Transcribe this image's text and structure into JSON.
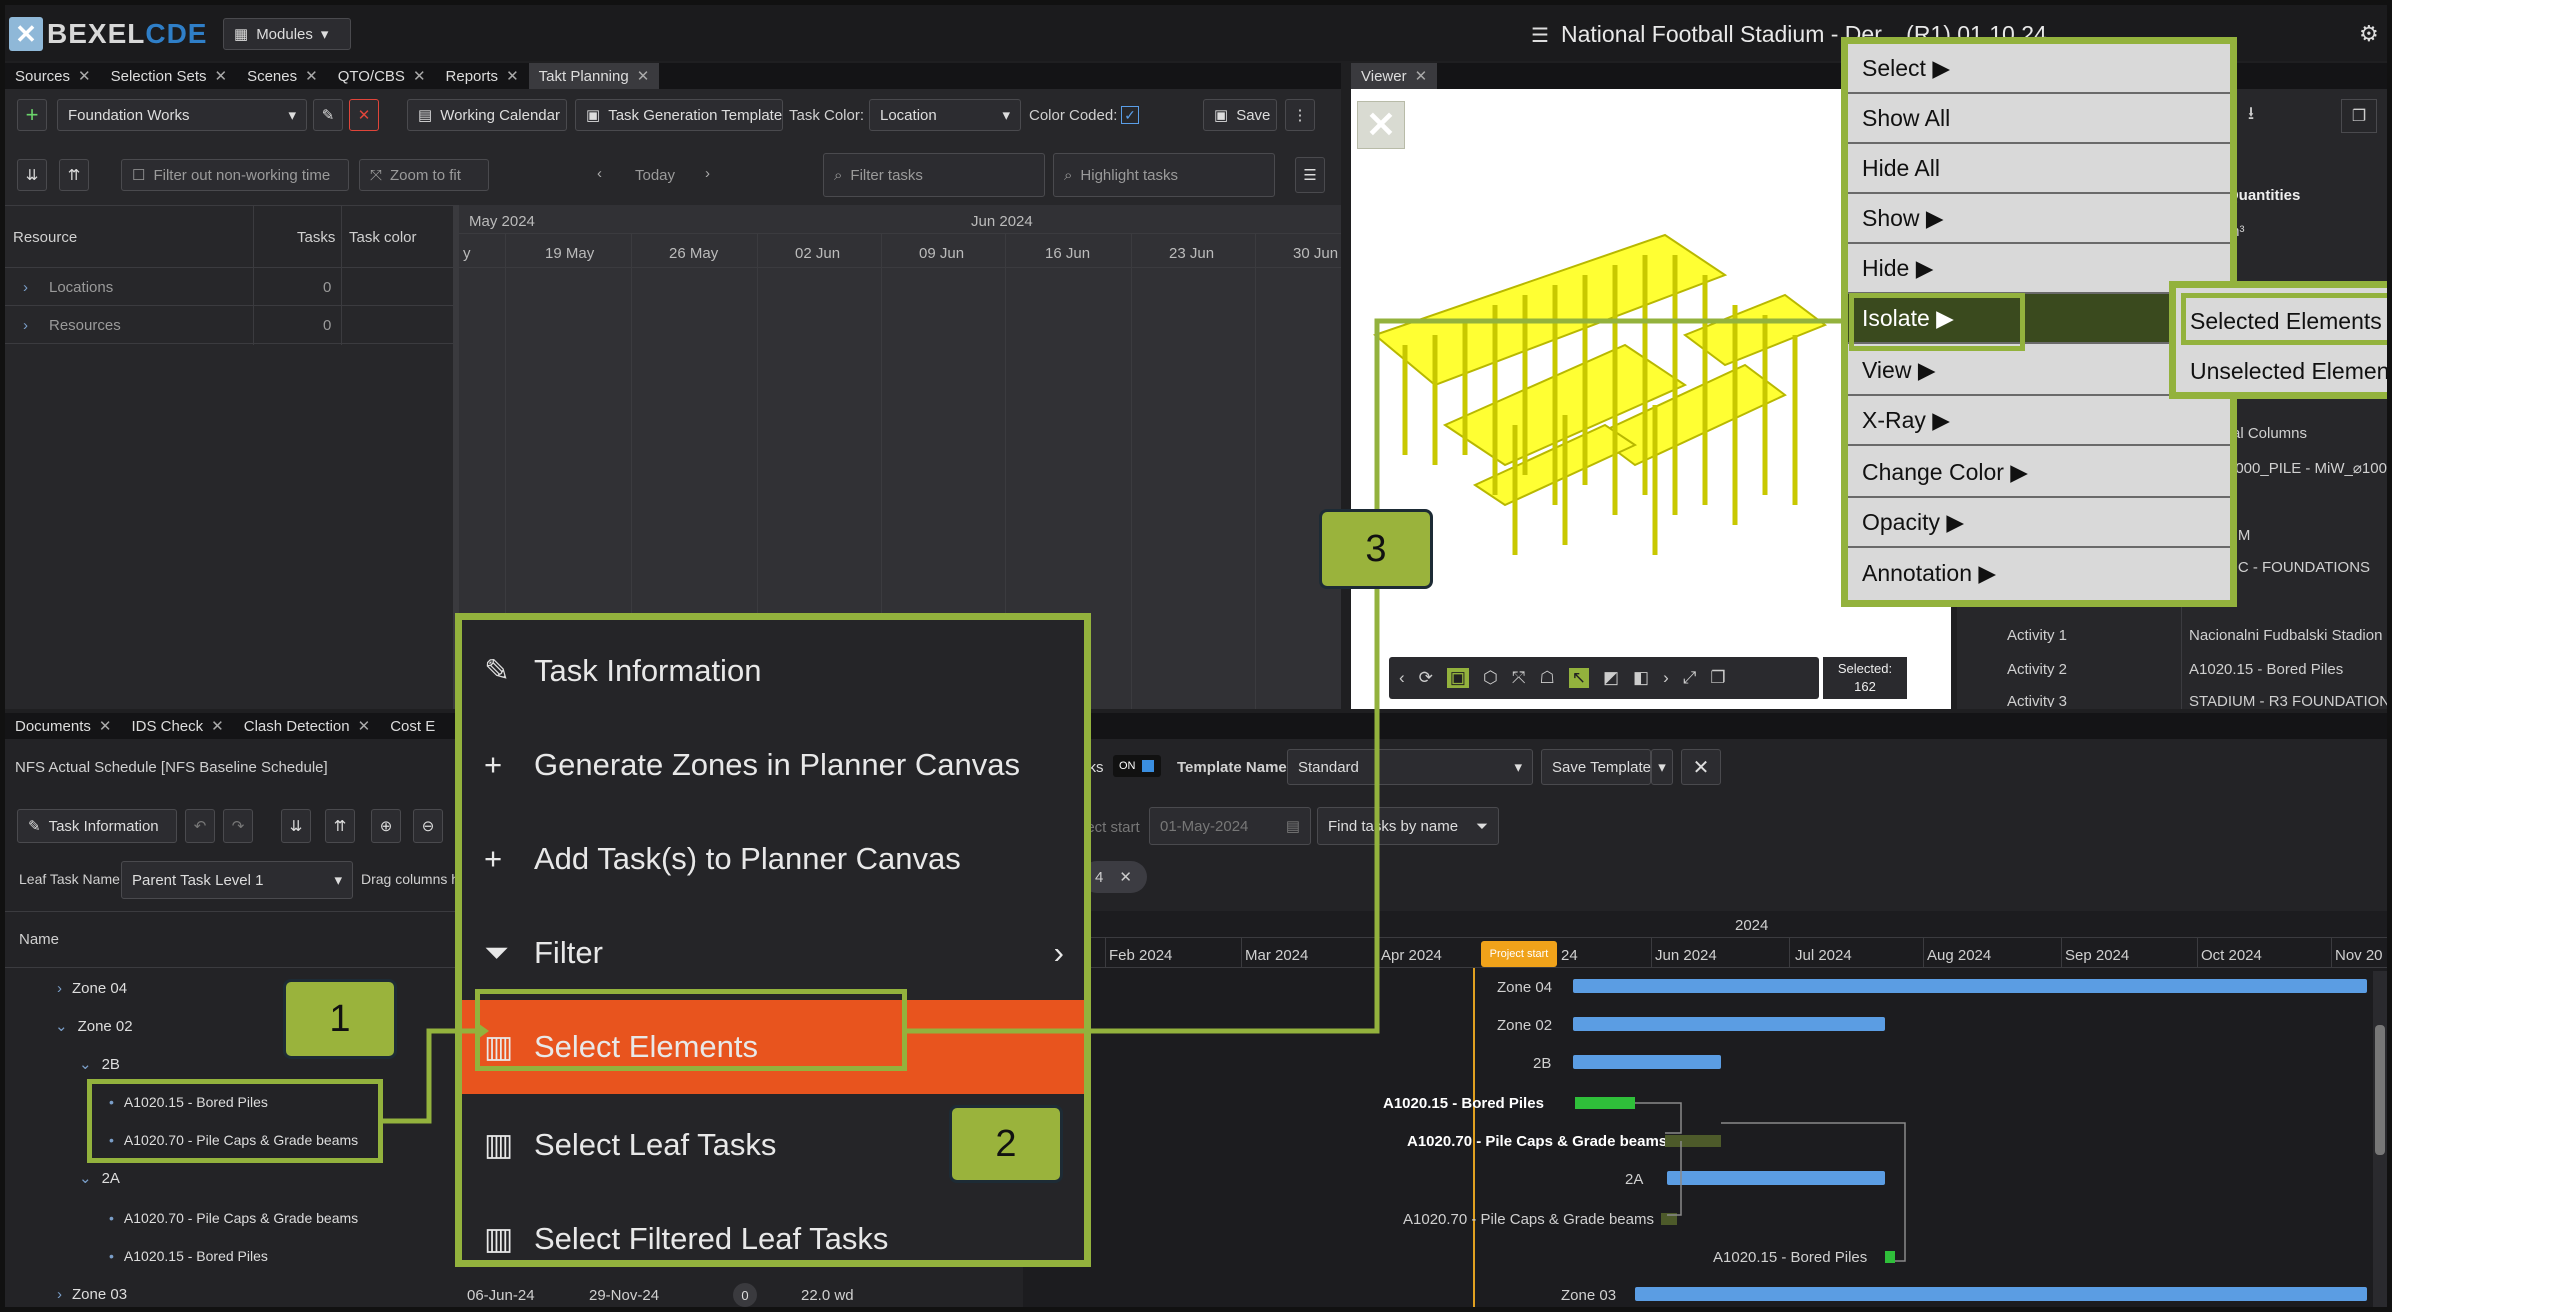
{
  "app": {
    "brand_a": "BEXEL",
    "brand_b": "CDE",
    "modules": "Modules",
    "title": "National Football Stadium - Der... (R1) 01.10.24"
  },
  "colors": {
    "accent": "#93b23d",
    "badge": "#9ab33c",
    "highlight": "#e8541e",
    "bar_blue": "#5b9de3",
    "bar_green": "#2fbf3a",
    "model_yellow": "#ffff33"
  },
  "top_tabs": [
    "Sources",
    "Selection Sets",
    "Scenes",
    "QTO/CBS",
    "Reports",
    "Takt Planning"
  ],
  "takt": {
    "project": "Foundation Works",
    "working_calendar": "Working Calendar",
    "task_gen_template": "Task Generation Template",
    "task_color_label": "Task Color:",
    "task_color_value": "Location",
    "color_coded_label": "Color Coded:",
    "save": "Save",
    "filter_nonworking": "Filter out non-working time",
    "zoom_fit": "Zoom to fit",
    "today": "Today",
    "filter_tasks": "Filter tasks",
    "highlight_tasks": "Highlight tasks",
    "columns": {
      "resource": "Resource",
      "tasks": "Tasks",
      "task_color": "Task color"
    },
    "rows": [
      {
        "name": "Locations",
        "tasks": "0"
      },
      {
        "name": "Resources",
        "tasks": "0"
      }
    ],
    "months": [
      "May 2024",
      "Jun 2024"
    ],
    "weeks": [
      "y",
      "19 May",
      "26 May",
      "02 Jun",
      "09 Jun",
      "16 Jun",
      "23 Jun",
      "30 Jun"
    ]
  },
  "viewer": {
    "tab": "Viewer",
    "selected_label": "Selected:",
    "selected_count": "162"
  },
  "props": {
    "header": "Quantities",
    "unit": "m³",
    "rows": [
      {
        "k": "",
        "v": "ral Columns"
      },
      {
        "k": "",
        "v": "1000_PILE - MiW_⌀100"
      },
      {
        "k": "",
        "v": "UM"
      },
      {
        "k": "",
        "v": "RC - FOUNDATIONS"
      },
      {
        "k": "Activity 1",
        "v": "Nacionalni Fudbalski Stadion"
      },
      {
        "k": "Activity 2",
        "v": "A1020.15 - Bored Piles"
      },
      {
        "k": "Activity 3",
        "v": "STADIUM - R3 FOUNDATION"
      }
    ]
  },
  "bottom_tabs": [
    "Documents",
    "IDS Check",
    "Clash Detection",
    "Cost E"
  ],
  "schedule": {
    "title": "NFS Actual Schedule [NFS Baseline Schedule]",
    "task_info": "Task Information",
    "leaf_label": "Leaf Task Name:",
    "leaf_value": "Parent Task Level 1",
    "drag_hint": "Drag columns h",
    "name_col": "Name",
    "toggle_label": "sks",
    "toggle_state": "ON",
    "template_label": "Template Name:",
    "template_value": "Standard",
    "save_template": "Save Template",
    "project_start_label": "ject start",
    "project_start_date": "01-May-2024",
    "find_tasks": "Find tasks by name",
    "chip": "4",
    "tree": [
      "Zone 04",
      "Zone 02",
      "2B",
      "A1020.15 - Bored Piles",
      "A1020.70 - Pile Caps & Grade beams",
      "2A",
      "A1020.70 - Pile Caps & Grade beams",
      "A1020.15 - Bored Piles",
      "Zone 03"
    ],
    "zone03_start": "06-Jun-24",
    "zone03_end": "29-Nov-24",
    "zone03_count": "0",
    "zone03_dur": "22.0 wd",
    "year": "2024",
    "months": [
      "Feb 2024",
      "Mar 2024",
      "Apr 2024",
      "Jun 2024",
      "Jul 2024",
      "Aug 2024",
      "Sep 2024",
      "Oct 2024",
      "Nov 20"
    ],
    "apr_tail": "24",
    "project_start": "Project start",
    "bar_labels": [
      "Zone 04",
      "Zone 02",
      "2B",
      "A1020.15 - Bored Piles",
      "A1020.70 - Pile Caps & Grade beams",
      "2A",
      "A1020.70 - Pile Caps & Grade beams",
      "A1020.15 - Bored Piles",
      "Zone 03"
    ]
  },
  "context_menu": [
    "Task Information",
    "Generate Zones in Planner Canvas",
    "Add Task(s) to Planner Canvas",
    "Filter",
    "Select Elements",
    "Select Leaf Tasks",
    "Select Filtered Leaf Tasks"
  ],
  "viewer_menu": [
    "Select ▶",
    "Show All",
    "Hide All",
    "Show ▶",
    "Hide ▶",
    "Isolate ▶",
    "View ▶",
    "X-Ray ▶",
    "Change Color ▶",
    "Opacity ▶",
    "Annotation ▶"
  ],
  "isolate_sub": [
    "Selected Elements",
    "Unselected Elements"
  ],
  "badges": [
    "1",
    "2",
    "3"
  ]
}
